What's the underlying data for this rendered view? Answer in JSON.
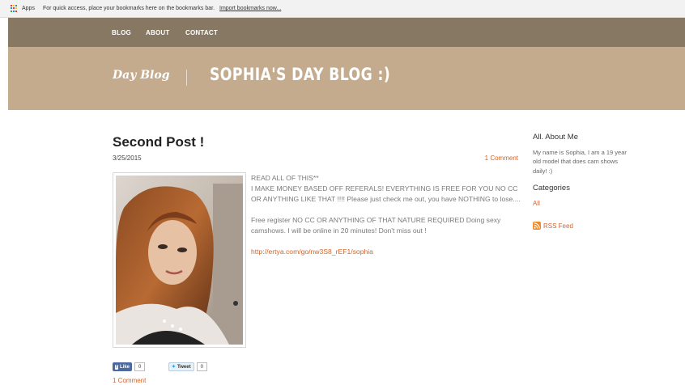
{
  "browser": {
    "bookmarks_bar": {
      "apps_label": "Apps",
      "message": "For quick access, place your bookmarks here on the bookmarks bar.",
      "import_link": "Import bookmarks now..."
    }
  },
  "nav": {
    "items": [
      "BLOG",
      "ABOUT",
      "CONTACT"
    ]
  },
  "header": {
    "logo": "Day Blog",
    "title": "SOPHIA'S DAY BLOG :)"
  },
  "post": {
    "title": "Second Post !",
    "date": "3/25/2015",
    "comments": "1 Comment",
    "body": [
      "READ ALL OF THIS**",
      "I MAKE MONEY BASED OFF REFERALS! EVERYTHING IS FREE FOR YOU NO CC OR ANYTHING LIKE THAT !!!! Please just check me out, you have NOTHING to lose....",
      "Free register  NO CC OR ANYTHING OF THAT NATURE REQUIRED Doing sexy camshows. I will be online in 20 minutes! Don't miss out !"
    ],
    "link": "http://ertya.com/go/nw3S8_rEF1/sophia",
    "social": {
      "like_label": "Like",
      "like_count": "0",
      "tweet_label": "Tweet",
      "tweet_count": "0"
    },
    "bottom_comments": "1 Comment"
  },
  "sidebar": {
    "about_heading": "All. About Me",
    "about_text": "My name is Sophia, I am a 19 year old model  that does cam shows daily! :)",
    "categories_heading": "Categories",
    "category_all": "All",
    "rss_label": "RSS Feed"
  },
  "colors": {
    "nav_bg": "#867862",
    "banner_bg": "#c4ab8d",
    "accent_link": "#d1642b"
  }
}
